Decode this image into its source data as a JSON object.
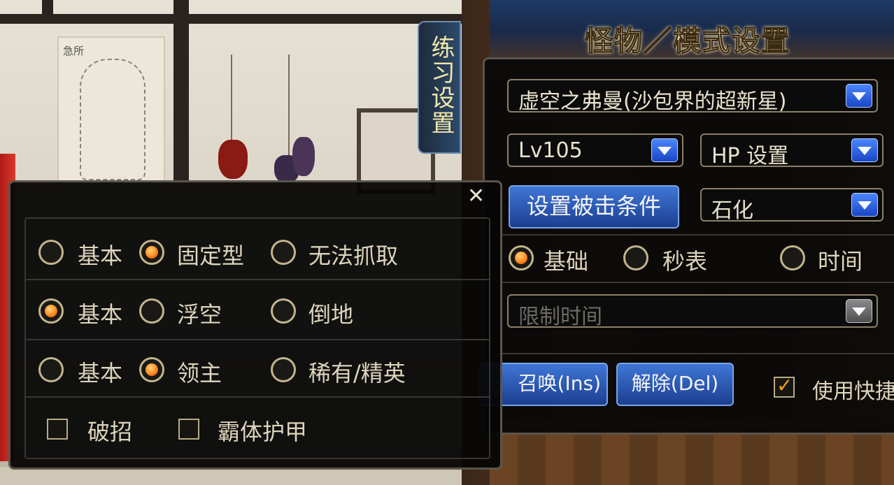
{
  "practice_tab": {
    "label": "练习设置"
  },
  "monster_panel": {
    "title": "怪物／模式设置",
    "monster_select": {
      "value": "虚空之弗曼(沙包界的超新星)"
    },
    "level_select": {
      "value": "Lv105"
    },
    "hp_select": {
      "value": "HP 设置"
    },
    "hit_condition_button": {
      "label": "设置被击条件"
    },
    "status_select": {
      "value": "石化"
    },
    "mode_radios": [
      {
        "label": "基础",
        "checked": true
      },
      {
        "label": "秒表",
        "checked": false
      },
      {
        "label": "时间",
        "checked": false
      }
    ],
    "time_limit_select": {
      "value": "限制时间",
      "disabled": true
    },
    "summon_button": {
      "label": "召唤(Ins)"
    },
    "release_button": {
      "label": "解除(Del)"
    },
    "shortcut_checkbox": {
      "label": "使用快捷",
      "checked": true
    }
  },
  "hit_condition_popup": {
    "close_icon": "close-icon",
    "rows": [
      [
        {
          "label": "基本",
          "checked": false
        },
        {
          "label": "固定型",
          "checked": true
        },
        {
          "label": "无法抓取",
          "checked": false
        }
      ],
      [
        {
          "label": "基本",
          "checked": true
        },
        {
          "label": "浮空",
          "checked": false
        },
        {
          "label": "倒地",
          "checked": false
        }
      ],
      [
        {
          "label": "基本",
          "checked": false
        },
        {
          "label": "领主",
          "checked": true
        },
        {
          "label": "稀有/精英",
          "checked": false
        }
      ]
    ],
    "checkboxes": [
      {
        "label": "破招",
        "checked": false
      },
      {
        "label": "霸体护甲",
        "checked": false
      }
    ]
  },
  "colors": {
    "accent_blue": "#2a5bd0",
    "radio_on": "#ff8a1f",
    "text": "#ddd4bb"
  }
}
